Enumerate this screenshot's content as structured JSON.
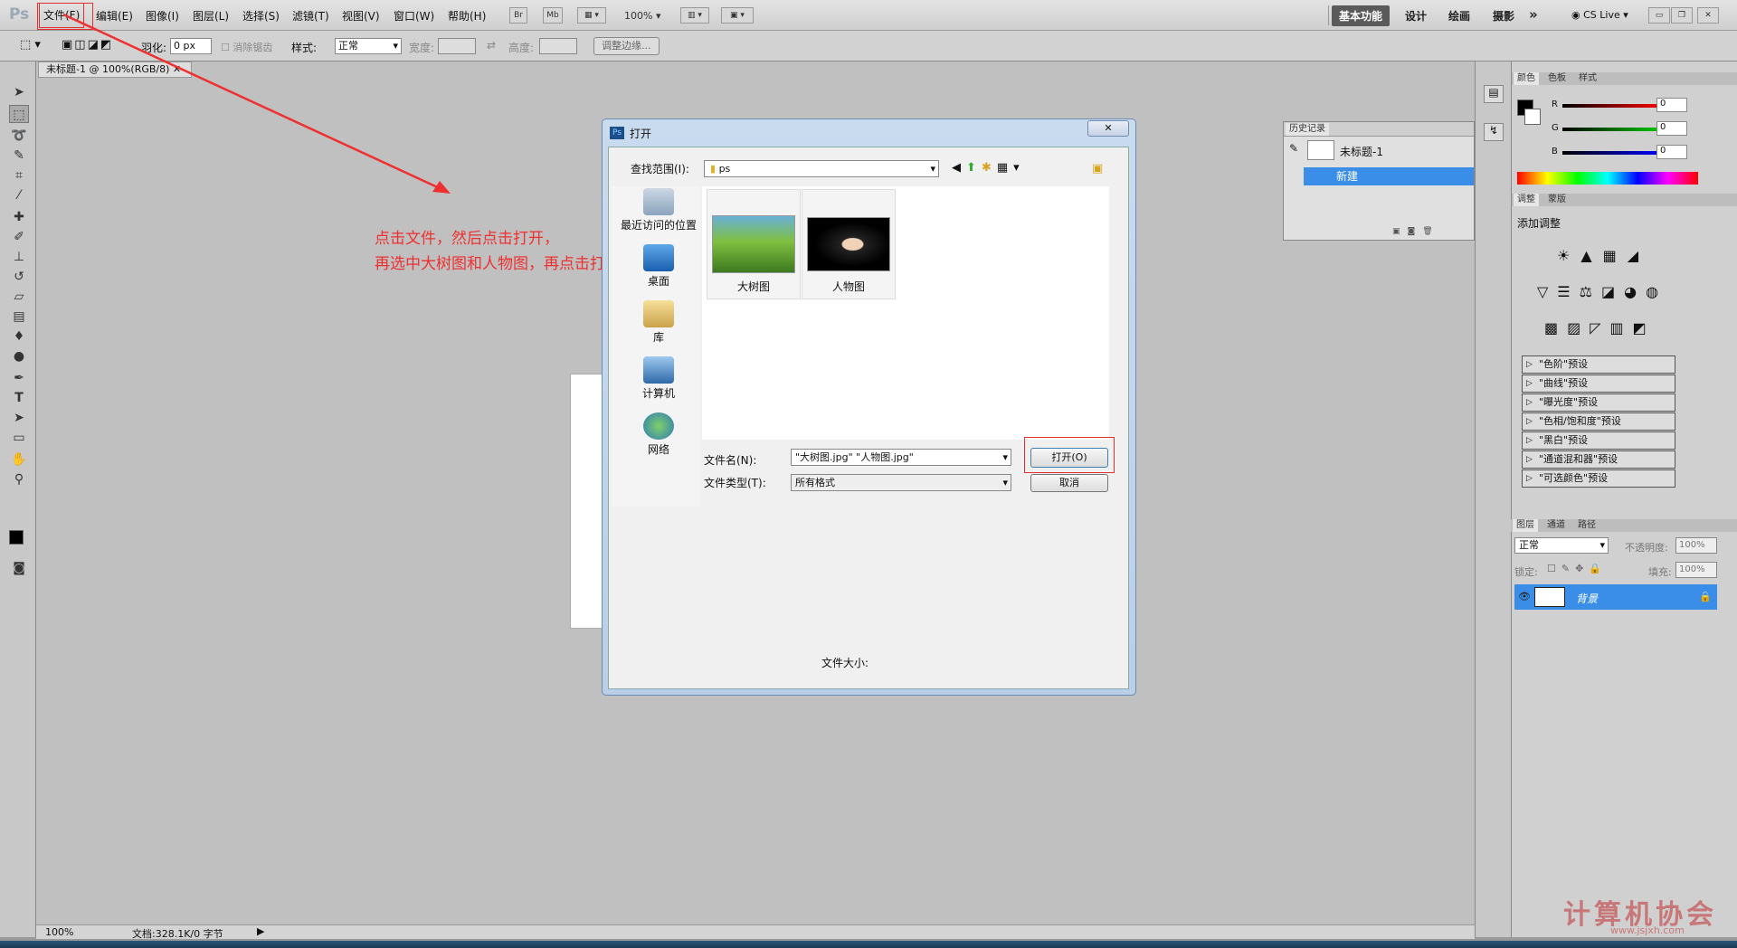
{
  "app": {
    "logo": "Ps"
  },
  "menu": [
    "文件(F)",
    "编辑(E)",
    "图像(I)",
    "图层(L)",
    "选择(S)",
    "滤镜(T)",
    "视图(V)",
    "窗口(W)",
    "帮助(H)"
  ],
  "menubar": {
    "br": "Br",
    "mb": "Mb",
    "zoom": "100%",
    "workspaces": [
      "基本功能",
      "设计",
      "绘画",
      "摄影"
    ],
    "more": "»",
    "cslive": "CS Live"
  },
  "options": {
    "feather_label": "羽化:",
    "feather_value": "0 px",
    "antialias": "消除锯齿",
    "style_label": "样式:",
    "style_value": "正常",
    "width_label": "宽度:",
    "height_label": "高度:",
    "refine_button": "调整边缘..."
  },
  "document": {
    "tab": "未标题-1 @ 100%(RGB/8)",
    "status_zoom": "100%",
    "status_info": "文档:328.1K/0 字节"
  },
  "annotation": {
    "line1": "点击文件，然后点击打开，",
    "line2": "再选中大树图和人物图，再点击打开",
    "color": "#ee3030"
  },
  "dialog": {
    "title": "打开",
    "lookin_label": "查找范围(I):",
    "lookin_value": "ps",
    "places": [
      "最近访问的位置",
      "桌面",
      "库",
      "计算机",
      "网络"
    ],
    "files": [
      {
        "name": "大树图"
      },
      {
        "name": "人物图"
      }
    ],
    "filename_label": "文件名(N):",
    "filename_value": "\"大树图.jpg\" \"人物图.jpg\"",
    "filetype_label": "文件类型(T):",
    "filetype_value": "所有格式",
    "open_button": "打开(O)",
    "cancel_button": "取消",
    "filesize_label": "文件大小:"
  },
  "history": {
    "tab": "历史记录",
    "snapshot": "未标题-1",
    "step": "新建"
  },
  "color_panel": {
    "tabs": [
      "颜色",
      "色板",
      "样式"
    ],
    "channels": [
      {
        "label": "R",
        "value": "0"
      },
      {
        "label": "G",
        "value": "0"
      },
      {
        "label": "B",
        "value": "0"
      }
    ]
  },
  "adjust_panel": {
    "tabs": [
      "调整",
      "蒙版"
    ],
    "title": "添加调整",
    "presets": [
      "\"色阶\"预设",
      "\"曲线\"预设",
      "\"曝光度\"预设",
      "\"色相/饱和度\"预设",
      "\"黑白\"预设",
      "\"通道混和器\"预设",
      "\"可选颜色\"预设"
    ]
  },
  "layers_panel": {
    "tabs": [
      "图层",
      "通道",
      "路径"
    ],
    "blend": "正常",
    "opacity_label": "不透明度:",
    "opacity": "100%",
    "lock_label": "锁定:",
    "fill_label": "填充:",
    "fill": "100%",
    "layer_name": "背景"
  },
  "watermark": "计算机协会",
  "watermark_url": "www.jsjxh.com"
}
